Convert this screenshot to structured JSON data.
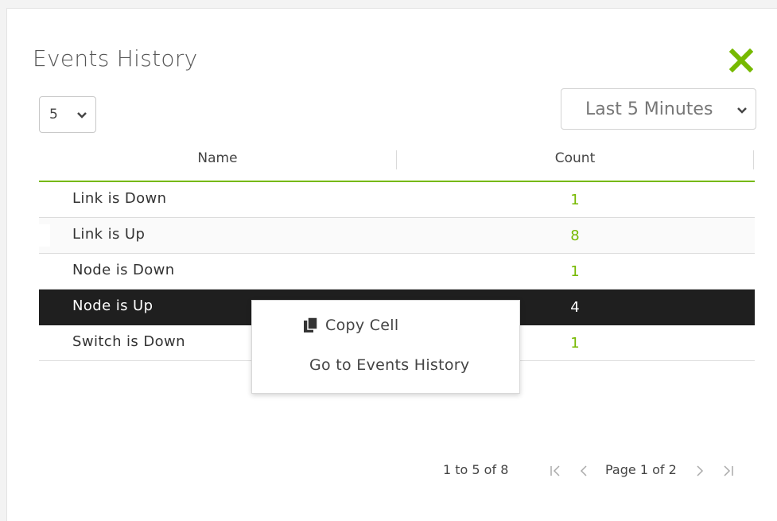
{
  "window": {
    "title": "Events History"
  },
  "controls": {
    "page_size_value": "5",
    "time_range_value": "Last 5 Minutes"
  },
  "grid": {
    "columns": [
      "Name",
      "Count"
    ],
    "rows": [
      {
        "name": "Link is Down",
        "count": "1"
      },
      {
        "name": "Link is Up",
        "count": "8"
      },
      {
        "name": "Node is Down",
        "count": "1"
      },
      {
        "name": "Node is Up",
        "count": "4",
        "selected": true
      },
      {
        "name": "Switch is Down",
        "count": "1"
      }
    ]
  },
  "context_menu": {
    "items": [
      {
        "label": "Copy Cell",
        "icon": "copy-icon"
      },
      {
        "label": "Go to Events History"
      }
    ]
  },
  "pagination": {
    "summary": "1 to 5 of 8",
    "page_label": "Page 1 of 2"
  },
  "colors": {
    "accent": "#76b900",
    "selected_row": "#1f1f1f"
  }
}
